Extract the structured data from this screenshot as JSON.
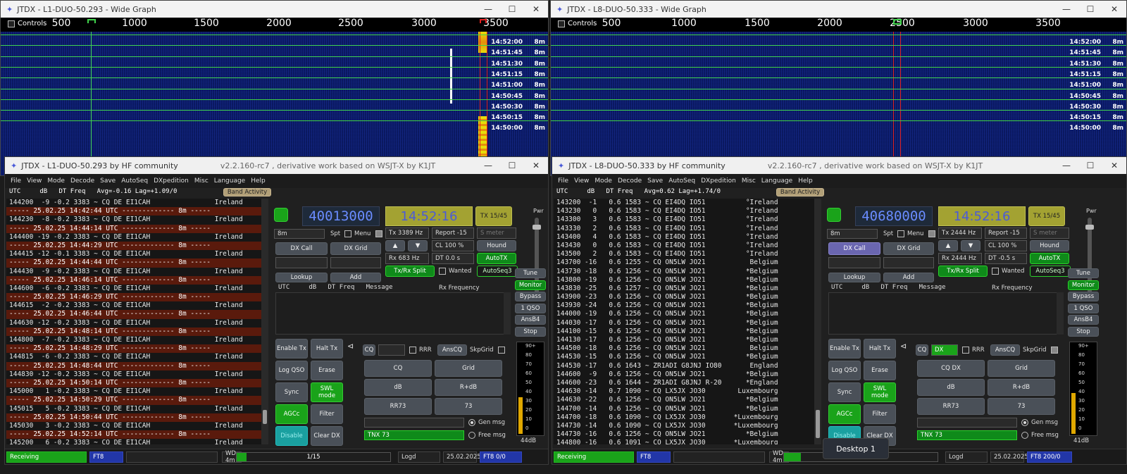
{
  "wg_left": {
    "title": "JTDX - L1-DUO-50.293 - Wide Graph",
    "controls_label": "Controls",
    "ticks": [
      "500",
      "1000",
      "1500",
      "2000",
      "2500",
      "3000",
      "3500"
    ],
    "times": [
      "14:52:00",
      "14:51:45",
      "14:51:30",
      "14:51:15",
      "14:51:00",
      "14:50:45",
      "14:50:30",
      "14:50:15",
      "14:50:00"
    ],
    "band": "8m"
  },
  "wg_right": {
    "title": "JTDX - L8-DUO-50.333 - Wide Graph",
    "controls_label": "Controls",
    "ticks": [
      "500",
      "1000",
      "1500",
      "2000",
      "2500",
      "3000",
      "3500"
    ],
    "times": [
      "14:52:00",
      "14:51:45",
      "14:51:30",
      "14:51:15",
      "14:51:00",
      "14:50:45",
      "14:50:30",
      "14:50:15",
      "14:50:00"
    ],
    "band": "8m"
  },
  "menu": [
    "File",
    "View",
    "Mode",
    "Decode",
    "Save",
    "AutoSeq",
    "DXpedition",
    "Misc",
    "Language",
    "Help"
  ],
  "left": {
    "title": "JTDX - L1-DUO-50.293   by HF community",
    "subtitle": "v2.2.160-rc7 , derivative work based on WSJT-X by K1JT",
    "band_header": "UTC     dB   DT Freq   Avg=-0.16 Lag=+1.09/0",
    "band_activity": "Band Activity",
    "rows": [
      {
        "t": "144200  -9 -0.2 3383 ~ CQ DE EI1CAH                Ireland",
        "sep": false
      },
      {
        "t": "----- 25.02.25 14:42:44 UTC ------------- 8m -----",
        "sep": true
      },
      {
        "t": "144230  -8 -0.2 3383 ~ CQ DE EI1CAH                Ireland",
        "sep": false
      },
      {
        "t": "----- 25.02.25 14:44:14 UTC ------------- 8m -----",
        "sep": true
      },
      {
        "t": "144400 -19 -0.2 3383 ~ CQ DE EI1CAH                Ireland",
        "sep": false
      },
      {
        "t": "----- 25.02.25 14:44:29 UTC ------------- 8m -----",
        "sep": true
      },
      {
        "t": "144415 -12 -0.1 3383 ~ CQ DE EI1CAH                Ireland",
        "sep": false
      },
      {
        "t": "----- 25.02.25 14:44:44 UTC ------------- 8m -----",
        "sep": true
      },
      {
        "t": "144430  -9 -0.2 3383 ~ CQ DE EI1CAH                Ireland",
        "sep": false
      },
      {
        "t": "----- 25.02.25 14:46:14 UTC ------------- 8m -----",
        "sep": true
      },
      {
        "t": "144600  -6 -0.2 3383 ~ CQ DE EI1CAH                Ireland",
        "sep": false
      },
      {
        "t": "----- 25.02.25 14:46:29 UTC ------------- 8m -----",
        "sep": true
      },
      {
        "t": "144615  -2 -0.2 3383 ~ CQ DE EI1CAH                Ireland",
        "sep": false
      },
      {
        "t": "----- 25.02.25 14:46:44 UTC ------------- 8m -----",
        "sep": true
      },
      {
        "t": "144630 -12 -0.2 3383 ~ CQ DE EI1CAH                Ireland",
        "sep": false
      },
      {
        "t": "----- 25.02.25 14:48:14 UTC ------------- 8m -----",
        "sep": true
      },
      {
        "t": "144800  -7 -0.2 3383 ~ CQ DE EI1CAH                Ireland",
        "sep": false
      },
      {
        "t": "----- 25.02.25 14:48:29 UTC ------------- 8m -----",
        "sep": true
      },
      {
        "t": "144815  -6 -0.2 3383 ~ CQ DE EI1CAH                Ireland",
        "sep": false
      },
      {
        "t": "----- 25.02.25 14:48:44 UTC ------------- 8m -----",
        "sep": true
      },
      {
        "t": "144830 -12 -0.2 3383 ~ CQ DE EI1CAH                Ireland",
        "sep": false
      },
      {
        "t": "----- 25.02.25 14:50:14 UTC ------------- 8m -----",
        "sep": true
      },
      {
        "t": "145000   1 -0.2 3383 ~ CQ DE EI1CAH                Ireland",
        "sep": false
      },
      {
        "t": "----- 25.02.25 14:50:29 UTC ------------- 8m -----",
        "sep": true
      },
      {
        "t": "145015   5 -0.2 3383 ~ CQ DE EI1CAH                Ireland",
        "sep": false
      },
      {
        "t": "----- 25.02.25 14:50:44 UTC ------------- 8m -----",
        "sep": true
      },
      {
        "t": "145030   3 -0.2 3383 ~ CQ DE EI1CAH                Ireland",
        "sep": false
      },
      {
        "t": "----- 25.02.25 14:52:14 UTC ------------- 8m -----",
        "sep": true
      },
      {
        "t": "145200   6 -0.2 3383 ~ CQ DE EI1CAH                Ireland",
        "sep": false
      }
    ],
    "freq": "40013000",
    "clock": "14:52:16",
    "tx_period": "TX 15/45",
    "band_sel": "8m",
    "tx_hz": "Tx  3389  Hz",
    "rx_hz": "Rx  683  Hz",
    "report": "Report -15",
    "cl": "CL  100 %",
    "dt": "DT  0.0 s",
    "smeter": "S meter",
    "dt_field": "",
    "cq_text": "",
    "gen_select": "TNX 73",
    "dx_call": "DX Call",
    "status": {
      "state": "Receiving",
      "mode": "FT8",
      "wd": "WD 4m",
      "progress": "1/15",
      "progress_frac": 0.066,
      "logd": "Logd",
      "date": "25.02.2025",
      "mode2": "FT8  0/0"
    },
    "meter_level": 0.4,
    "meter_text": "44dB"
  },
  "right": {
    "title": "JTDX - L8-DUO-50.333   by HF community",
    "subtitle": "v2.2.160-rc7 , derivative work based on WSJT-X by K1JT",
    "band_header": "UTC     dB   DT Freq   Avg=0.62 Lag=+1.74/0",
    "band_activity": "Band Activity",
    "rows": [
      {
        "t": "143200  -1   0.6 1583 ~ CQ EI4DQ IO51          °Ireland",
        "sep": false
      },
      {
        "t": "143230   0   0.6 1583 ~ CQ EI4DQ IO51          °Ireland",
        "sep": false
      },
      {
        "t": "143300   3   0.6 1583 ~ CQ EI4DQ IO51          °Ireland",
        "sep": false
      },
      {
        "t": "143330   2   0.6 1583 ~ CQ EI4DQ IO51          °Ireland",
        "sep": false
      },
      {
        "t": "143400   4   0.6 1583 ~ CQ EI4DQ IO51          °Ireland",
        "sep": false
      },
      {
        "t": "143430   0   0.6 1583 ~ CQ EI4DQ IO51          °Ireland",
        "sep": false
      },
      {
        "t": "143500   2   0.6 1583 ~ CQ EI4DQ IO51          °Ireland",
        "sep": false
      },
      {
        "t": "143700 -16   0.6 1255 ~ CQ ON5LW JO21           Belgium",
        "sep": false
      },
      {
        "t": "143730 -18   0.6 1256 ~ CQ ON5LW JO21          *Belgium",
        "sep": false
      },
      {
        "t": "143800 -19   0.6 1256 ~ CQ ON5LW JO21          *Belgium",
        "sep": false
      },
      {
        "t": "143830 -25   0.6 1257 ~ CQ ON5LW JO21          *Belgium",
        "sep": false
      },
      {
        "t": "143900 -23   0.6 1256 ~ CQ ON5LW JO21          *Belgium",
        "sep": false
      },
      {
        "t": "143930 -24   0.6 1256 ~ CQ ON5LW JO21          *Belgium",
        "sep": false
      },
      {
        "t": "144000 -19   0.6 1256 ~ CQ ON5LW JO21          *Belgium",
        "sep": false
      },
      {
        "t": "144030 -17   0.6 1256 ~ CQ ON5LW JO21          *Belgium",
        "sep": false
      },
      {
        "t": "144100 -15   0.6 1256 ~ CQ ON5LW JO21          *Belgium",
        "sep": false
      },
      {
        "t": "144130 -17   0.6 1256 ~ CQ ON5LW JO21          *Belgium",
        "sep": false
      },
      {
        "t": "144500 -18   0.6 1256 ~ CQ ON5LW JO21           Belgium",
        "sep": false
      },
      {
        "t": "144530 -15   0.6 1256 ~ CQ ON5LW JO21          *Belgium",
        "sep": false
      },
      {
        "t": "144530 -17   0.6 1643 ~ ZR1ADI G8JNJ IO80       England",
        "sep": false
      },
      {
        "t": "144600  -9   0.6 1256 ~ CQ ON5LW JO21          *Belgium",
        "sep": false
      },
      {
        "t": "144600 -23   0.6 1644 ~ ZR1ADI G8JNJ R-20      *England",
        "sep": false
      },
      {
        "t": "144630 -14   0.7 1090 ~ CQ LX5JX JO30        Luxembourg",
        "sep": false
      },
      {
        "t": "144630 -22   0.6 1256 ~ CQ ON5LW JO21          *Belgium",
        "sep": false
      },
      {
        "t": "144700 -14   0.6 1256 ~ CQ ON5LW JO21          *Belgium",
        "sep": false
      },
      {
        "t": "144700 -18   0.6 1090 ~ CQ LX5JX JO30       *Luxembourg",
        "sep": false
      },
      {
        "t": "144730 -14   0.6 1090 ~ CQ LX5JX JO30       *Luxembourg",
        "sep": false
      },
      {
        "t": "144730 -16   0.6 1256 ~ CQ ON5LW JO21          *Belgium",
        "sep": false
      },
      {
        "t": "144800 -16   0.6 1091 ~ CQ LX5JX JO30       *Luxembourg",
        "sep": false
      }
    ],
    "freq": "40680000",
    "clock": "14:52:16",
    "tx_period": "TX 15/45",
    "band_sel": "8m",
    "tx_hz": "Tx  2444  Hz",
    "rx_hz": "Rx  2444  Hz",
    "report": "Report -15",
    "cl": "CL  100 %",
    "dt": "DT  -0.5 s",
    "smeter": "S meter",
    "cq_text": "DX",
    "gen_select": "TNX 73",
    "dx_call": "DX Call",
    "status": {
      "state": "Receiving",
      "mode": "FT8",
      "wd": "WD 4m",
      "progress": "",
      "progress_frac": 0.11,
      "logd": "Logd",
      "date": "25.02.2025",
      "mode2": "FT8  200/0"
    },
    "meter_level": 0.45,
    "meter_text": "41dB"
  },
  "common": {
    "spt": "Spt",
    "menu_cb": "Menu",
    "dx_grid": "DX Grid",
    "hound": "Hound",
    "autotx": "AutoTX",
    "autoseq3": "AutoSeq3",
    "txrx_split": "Tx/Rx Split",
    "wanted": "Wanted",
    "lookup": "Lookup",
    "add": "Add",
    "rx_header": "UTC     dB   DT Freq   Message",
    "rx_freq_label": "Rx Frequency",
    "tune": "Tune",
    "monitor": "Monitor",
    "bypass": "Bypass",
    "oneqso": "1 QSO",
    "ansb4": "AnsB4",
    "stop": "Stop",
    "enable_tx": "Enable Tx",
    "halt_tx": "Halt Tx",
    "log_qso": "Log QSO",
    "erase": "Erase",
    "sync": "Sync",
    "swl_mode": "SWL mode",
    "agcc": "AGCc",
    "filter": "Filter",
    "disable": "Disable",
    "clear_dx": "Clear DX",
    "cq_label": "CQ",
    "rrr": "RRR",
    "anscq": "AnsCQ",
    "skpgrid": "SkpGrid",
    "btn_cq": "CQ",
    "btn_cqdx": "CQ DX",
    "btn_grid": "Grid",
    "btn_db": "dB",
    "btn_rdb": "R+dB",
    "btn_rr73": "RR73",
    "btn_73": "73",
    "gen_msg": "Gen msg",
    "free_msg": "Free msg",
    "pwr": "Pwr",
    "meter_ticks": [
      "90+",
      "80",
      "70",
      "60",
      "50",
      "40",
      "30",
      "20",
      "10",
      "0"
    ]
  },
  "desktop_tip": "Desktop 1"
}
